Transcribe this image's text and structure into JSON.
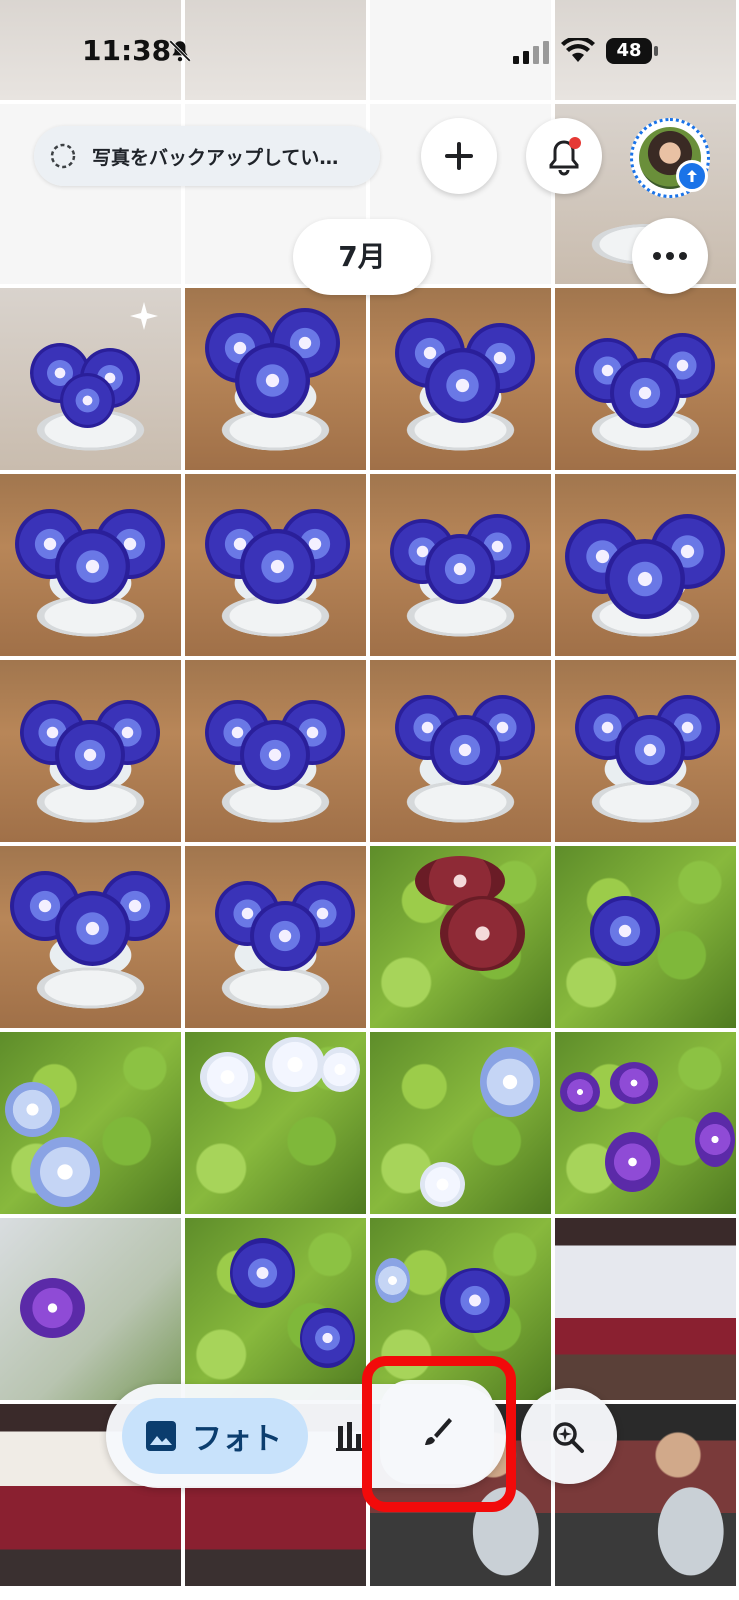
{
  "status_bar": {
    "time": "11:38",
    "battery": "48"
  },
  "header": {
    "backup_text": "写真をバックアップしてい…",
    "month_label": "7月"
  },
  "bottom_nav": {
    "photos_label": "フォト"
  },
  "icons": {
    "plus": "plus-icon",
    "bell": "notification-bell-icon",
    "more": "more-horizontal-icon",
    "edit": "brush-icon",
    "search": "ask-search-icon",
    "collections": "collections-icon"
  },
  "colors": {
    "accent": "#1a73e8",
    "active_tab_bg": "#c8e2fb",
    "notification_dot": "#e53935",
    "highlight_frame": "#f20a0a"
  }
}
